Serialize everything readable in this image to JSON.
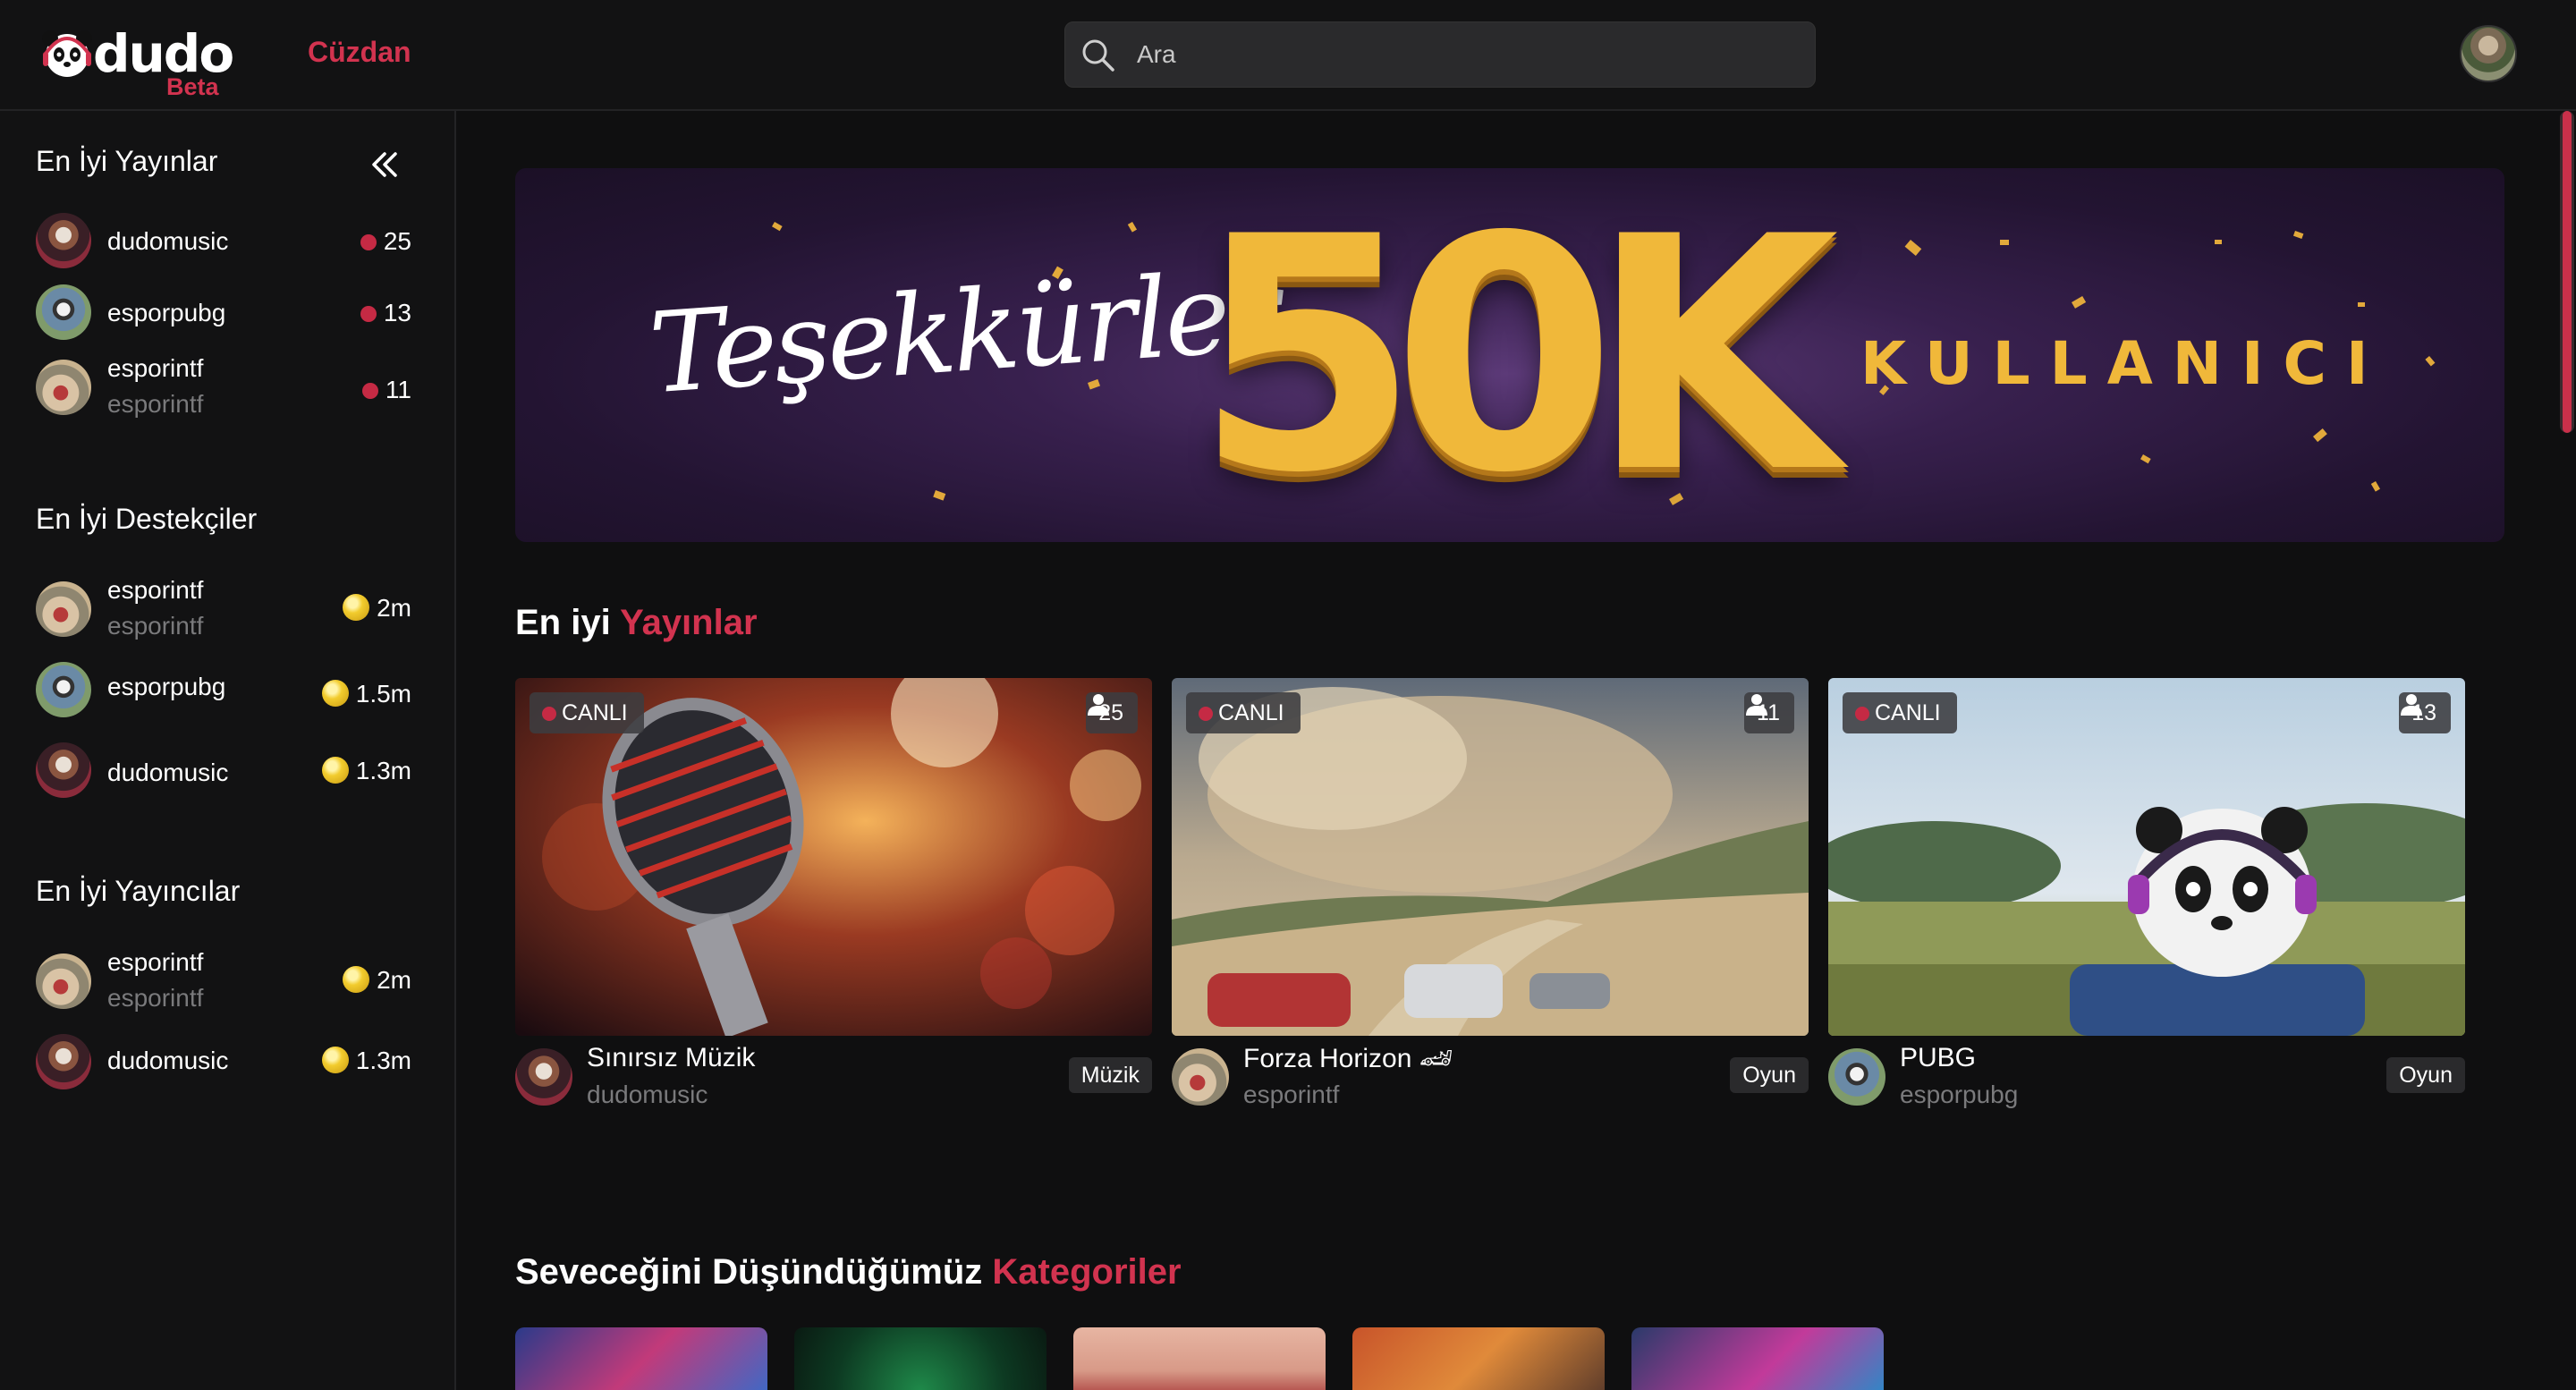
{
  "header": {
    "logo_text": "dudo",
    "logo_badge": "Beta",
    "wallet_label": "Cüzdan",
    "search_placeholder": "Ara"
  },
  "sidebar": {
    "top_streams": {
      "title": "En İyi Yayınlar",
      "items": [
        {
          "name": "dudomusic",
          "sub": "",
          "count": "25"
        },
        {
          "name": "esporpubg",
          "sub": "",
          "count": "13"
        },
        {
          "name": "esporintf",
          "sub": "esporintf",
          "count": "11"
        }
      ]
    },
    "top_supporters": {
      "title": "En İyi Destekçiler",
      "items": [
        {
          "name": "esporintf",
          "sub": "esporintf",
          "amount": "2m"
        },
        {
          "name": "esporpubg",
          "sub": "",
          "amount": "1.5m"
        },
        {
          "name": "dudomusic",
          "sub": "",
          "amount": "1.3m"
        }
      ]
    },
    "top_streamers": {
      "title": "En İyi Yayıncılar",
      "items": [
        {
          "name": "esporintf",
          "sub": "esporintf",
          "amount": "2m"
        },
        {
          "name": "dudomusic",
          "sub": "",
          "amount": "1.3m"
        }
      ]
    }
  },
  "banner": {
    "thanks": "Teşekkürler",
    "big_number": "50K",
    "users_label": "KULLANICI"
  },
  "streams_section": {
    "title_a": "En iyi",
    "title_b": "Yayınlar",
    "cards": [
      {
        "live": "CANLI",
        "viewers": "25",
        "title": "Sınırsız Müzik",
        "user": "dudomusic",
        "tag": "Müzik"
      },
      {
        "live": "CANLI",
        "viewers": "11",
        "title": "Forza Horizon 🏎",
        "user": "esporintf",
        "tag": "Oyun"
      },
      {
        "live": "CANLI",
        "viewers": "13",
        "title": "PUBG",
        "user": "esporpubg",
        "tag": "Oyun"
      }
    ]
  },
  "categories_section": {
    "title_a": "Seveceğini Düşündüğümüz",
    "title_b": "Kategoriler"
  },
  "colors": {
    "accent": "#d2334f",
    "background": "#0f0f10",
    "panel": "#121213",
    "gold": "#f0b83a"
  },
  "icons": [
    "panda-logo-icon",
    "search-icon",
    "collapse-icon",
    "live-dot-icon",
    "coin-icon",
    "user-icon"
  ]
}
